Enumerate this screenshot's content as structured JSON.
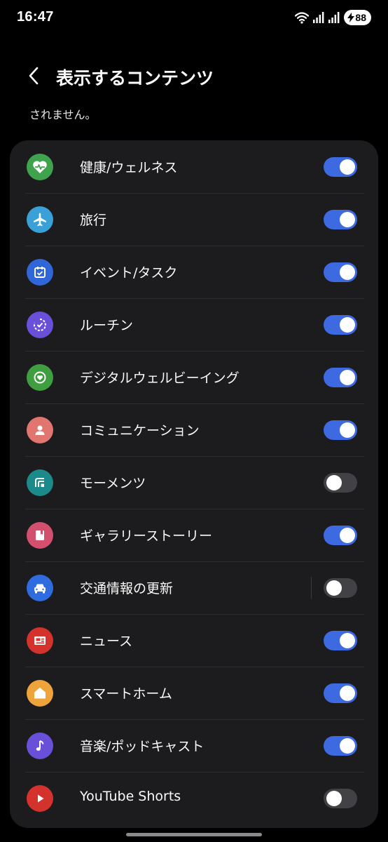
{
  "status_bar": {
    "time": "16:47",
    "battery": "88",
    "icons": [
      "wifi-icon",
      "signal-icon",
      "signal-icon",
      "battery-charging-icon"
    ]
  },
  "header": {
    "back_icon": "chevron-left-icon",
    "title": "表示するコンテンツ"
  },
  "subtitle": "されません。",
  "colors": {
    "background": "#000000",
    "card": "#1c1c1e",
    "toggle_on": "#3e6ae1",
    "toggle_off": "#424246"
  },
  "items": [
    {
      "label": "健康/ウェルネス",
      "icon": "heart-pulse-icon",
      "color": "#3fa34d",
      "on": true
    },
    {
      "label": "旅行",
      "icon": "airplane-icon",
      "color": "#3aa0d8",
      "on": true
    },
    {
      "label": "イベント/タスク",
      "icon": "calendar-check-icon",
      "color": "#3166d8",
      "on": true
    },
    {
      "label": "ルーチン",
      "icon": "routine-check-icon",
      "color": "#6a4fd8",
      "on": true
    },
    {
      "label": "デジタルウェルビーイング",
      "icon": "wellbeing-heart-icon",
      "color": "#3f9e3f",
      "on": true
    },
    {
      "label": "コミュニケーション",
      "icon": "person-icon",
      "color": "#e0766f",
      "on": true
    },
    {
      "label": "モーメンツ",
      "icon": "moments-icon",
      "color": "#1c8a8a",
      "on": false
    },
    {
      "label": "ギャラリーストーリー",
      "icon": "gallery-icon",
      "color": "#d2506e",
      "on": true
    },
    {
      "label": "交通情報の更新",
      "icon": "car-icon",
      "color": "#2e6ce0",
      "on": false
    },
    {
      "label": "ニュース",
      "icon": "news-icon",
      "color": "#d4322c",
      "on": true
    },
    {
      "label": "スマートホーム",
      "icon": "home-icon",
      "color": "#eea43b",
      "on": true
    },
    {
      "label": "音楽/ポッドキャスト",
      "icon": "music-note-icon",
      "color": "#6a4fd8",
      "on": true
    },
    {
      "label": "YouTube Shorts",
      "icon": "play-icon",
      "color": "#d4322c",
      "on": false
    }
  ]
}
